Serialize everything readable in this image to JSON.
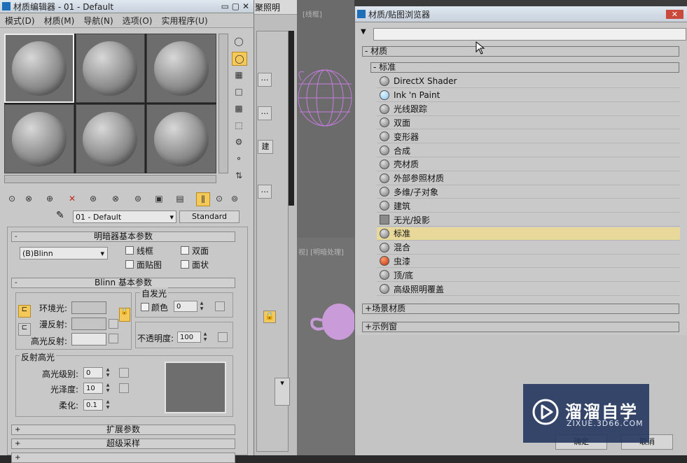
{
  "material_editor": {
    "title": "材质编辑器 - 01 - Default",
    "menus": [
      "模式(D)",
      "材质(M)",
      "导航(N)",
      "选项(O)",
      "实用程序(U)"
    ],
    "material_name": "01 - Default",
    "material_type": "Standard",
    "shader_rollout": {
      "title": "明暗器基本参数",
      "shader": "(B)Blinn",
      "options": [
        "线框",
        "双面",
        "面贴图",
        "面状"
      ]
    },
    "blinn_rollout": {
      "title": "Blinn 基本参数",
      "ambient_label": "环境光:",
      "diffuse_label": "漫反射:",
      "specular_label": "高光反射:",
      "self_illum_group": "自发光",
      "color_label": "颜色",
      "color_value": "0",
      "opacity_label": "不透明度:",
      "opacity_value": "100"
    },
    "specular_group": {
      "title": "反射高光",
      "level_label": "高光级别:",
      "level_value": "0",
      "gloss_label": "光泽度:",
      "gloss_value": "10",
      "soften_label": "柔化:",
      "soften_value": "0.1"
    },
    "collapsed_rollouts": [
      "扩展参数",
      "超级采样"
    ]
  },
  "viewport": {
    "label_top": "[线框]",
    "label_mid": "视] [明暗处理]"
  },
  "background_menu": "聚照明",
  "browser": {
    "title": "材质/贴图浏览器",
    "section": "材质",
    "subsection": "标准",
    "items": [
      {
        "label": "DirectX Shader",
        "icon": "sphere-grey-icon"
      },
      {
        "label": "Ink 'n Paint",
        "icon": "sphere-blue-icon"
      },
      {
        "label": "光线跟踪",
        "icon": "sphere-grey-icon"
      },
      {
        "label": "双面",
        "icon": "sphere-grey-icon"
      },
      {
        "label": "变形器",
        "icon": "sphere-grey-icon"
      },
      {
        "label": "合成",
        "icon": "sphere-grey-icon"
      },
      {
        "label": "壳材质",
        "icon": "sphere-grey-icon"
      },
      {
        "label": "外部参照材质",
        "icon": "sphere-grey-icon"
      },
      {
        "label": "多维/子对象",
        "icon": "sphere-grey-icon"
      },
      {
        "label": "建筑",
        "icon": "sphere-grey-icon"
      },
      {
        "label": "无光/投影",
        "icon": "square-grey-icon"
      },
      {
        "label": "标准",
        "icon": "sphere-grey-icon"
      },
      {
        "label": "混合",
        "icon": "sphere-grey-icon"
      },
      {
        "label": "虫漆",
        "icon": "sphere-red-icon"
      },
      {
        "label": "顶/底",
        "icon": "sphere-grey-icon"
      },
      {
        "label": "高级照明覆盖",
        "icon": "sphere-grey-icon"
      }
    ],
    "highlighted_item": "标准",
    "other_sections": [
      "场景材质",
      "示例窗"
    ],
    "ok_label": "确定",
    "cancel_label": "取消"
  },
  "watermark": {
    "name": "溜溜自学",
    "url": "ZIXUE.3D66.COM"
  },
  "colors": {
    "accent_yellow": "#f5c85a",
    "highlight_row": "#e8d99a",
    "watermark_bg": "#263760"
  }
}
